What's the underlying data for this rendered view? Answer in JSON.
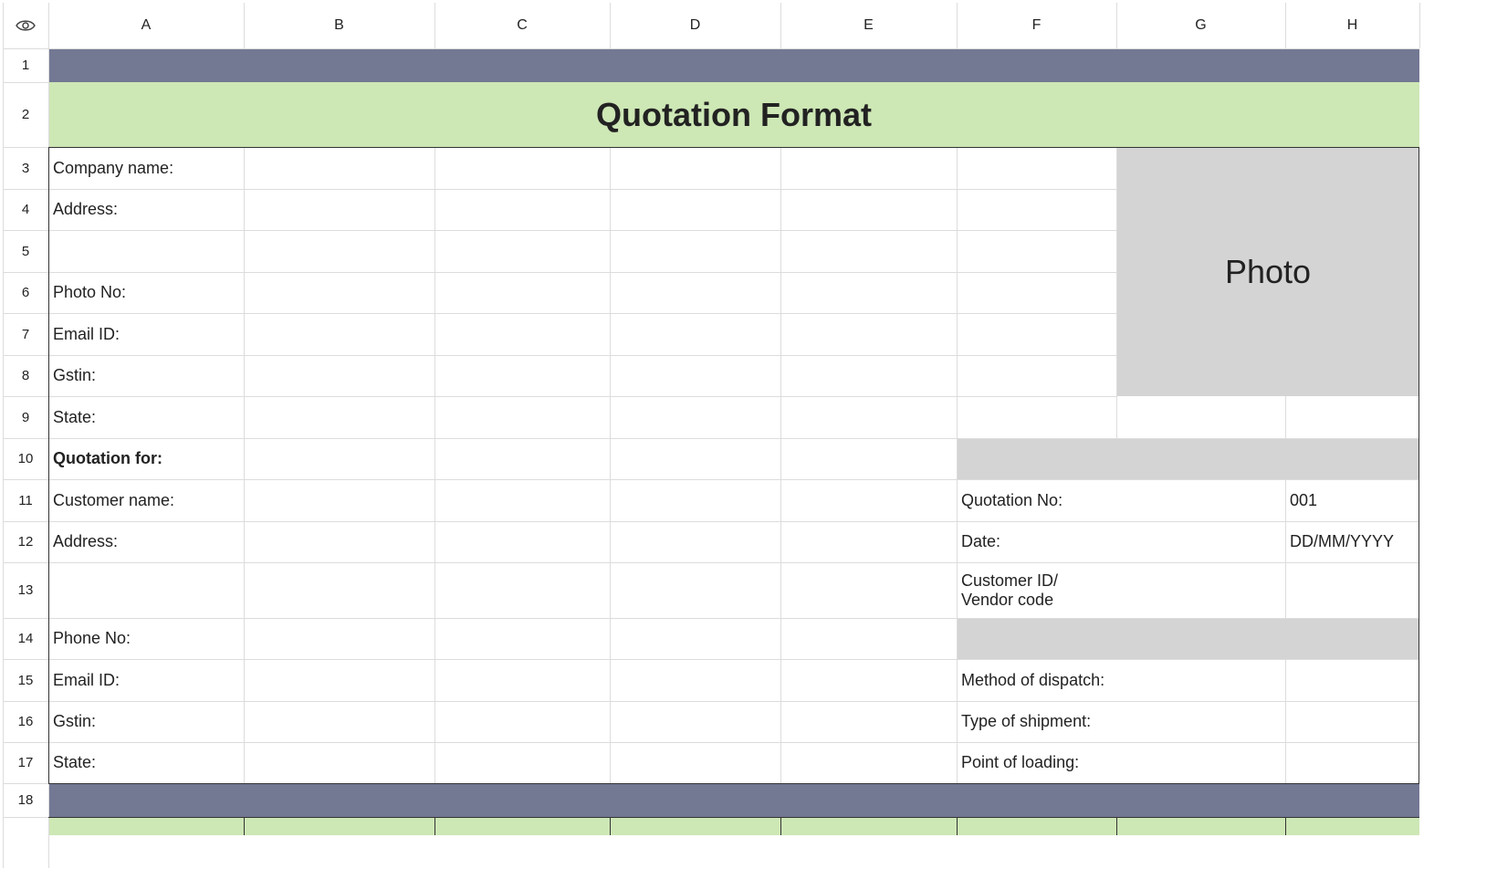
{
  "column_headers": [
    "A",
    "B",
    "C",
    "D",
    "E",
    "F",
    "G",
    "H"
  ],
  "row_headers": [
    "1",
    "2",
    "3",
    "4",
    "5",
    "6",
    "7",
    "8",
    "9",
    "10",
    "11",
    "12",
    "13",
    "14",
    "15",
    "16",
    "17",
    "18"
  ],
  "colors": {
    "band_dark": "#737893",
    "band_green": "#cde7b5",
    "gray_fill": "#d4d4d4",
    "grid": "#dcdcdc",
    "border": "#333333"
  },
  "title": "Quotation Format",
  "photo_placeholder": "Photo",
  "company_labels": {
    "company_name": "Company name:",
    "address": "Address:",
    "photo_no": "Photo No:",
    "email": "Email ID:",
    "gstin": "Gstin:",
    "state": "State:"
  },
  "quotation_for": "Quotation for:",
  "customer_labels": {
    "customer_name": "Customer name:",
    "address": "Address:",
    "phone_no": "Phone No:",
    "email": "Email ID:",
    "gstin": "Gstin:",
    "state": "State:"
  },
  "quote_info": {
    "quotation_no_label": "Quotation No:",
    "quotation_no_value": "001",
    "date_label": "Date:",
    "date_value": "DD/MM/YYYY",
    "customer_id_line1": "Customer ID/",
    "customer_id_line2": "Vendor code",
    "method_label": "Method of dispatch:",
    "shipment_label": "Type of shipment:",
    "loading_label": "Point of loading:"
  },
  "icons": {
    "visibility": "eye-icon"
  }
}
